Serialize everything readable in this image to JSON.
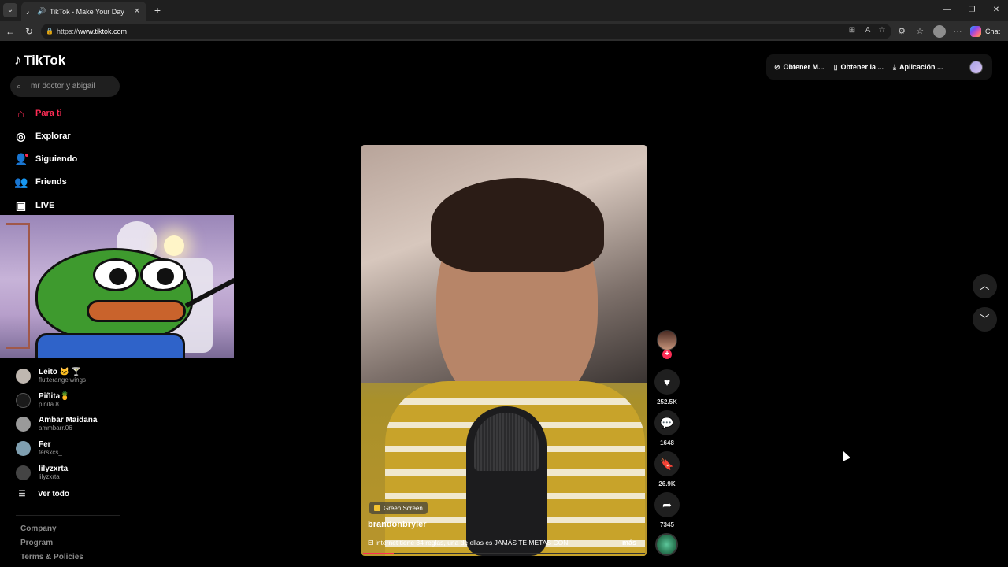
{
  "browser": {
    "tab_title": "TikTok - Make Your Day",
    "url_scheme": "https://",
    "url_host": "www.tiktok.com",
    "copilot_label": "Chat"
  },
  "app": {
    "logo_text": "TikTok",
    "search_placeholder": "mr doctor y abigail",
    "nav": [
      {
        "label": "Para ti",
        "icon": "home-icon",
        "active": true
      },
      {
        "label": "Explorar",
        "icon": "compass-icon"
      },
      {
        "label": "Siguiendo",
        "icon": "following-icon"
      },
      {
        "label": "Friends",
        "icon": "friends-icon"
      },
      {
        "label": "LIVE",
        "icon": "live-icon"
      }
    ],
    "following": [
      {
        "name": "Leito 🐱 🍸",
        "handle": "flutterangelwings"
      },
      {
        "name": "Piñita🍍",
        "handle": "pinita.8"
      },
      {
        "name": "Ambar Maidana",
        "handle": "ammbarr.06"
      },
      {
        "name": "Fer",
        "handle": "fersxcs_"
      },
      {
        "name": "lilyzxrta",
        "handle": "lilyzxrta"
      }
    ],
    "see_all": "Ver todo",
    "footer_links": [
      "Company",
      "Program",
      "Terms & Policies"
    ]
  },
  "topbar": {
    "coins": "Obtener M...",
    "get_app": "Obtener la ...",
    "desktop_app": "Aplicación ..."
  },
  "video": {
    "tag": "Green Screen",
    "author": "brandonbryler",
    "caption": "El internet tiene 34 reglas, una de ellas es JAMÁS TE METAS CON",
    "more": "más",
    "progress": 0.11
  },
  "actions": {
    "likes": "252.5K",
    "comments": "1648",
    "saves": "26.9K",
    "shares": "7345"
  },
  "colors": {
    "accent": "#fe2c55",
    "background": "#000000"
  }
}
